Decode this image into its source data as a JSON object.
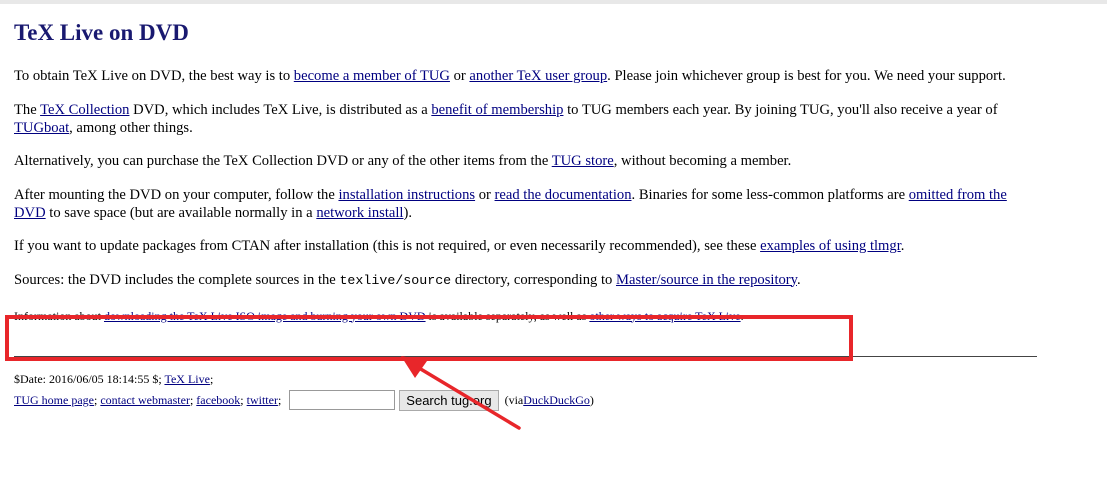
{
  "title": "TeX Live on DVD",
  "para1": {
    "t1": "To obtain TeX Live on DVD, the best way is to ",
    "link1": "become a member of TUG",
    "t2": " or ",
    "link2": "another TeX user group",
    "t3": ". Please join whichever group is best for you. We need your support."
  },
  "para2": {
    "t1": "The ",
    "link1": "TeX Collection",
    "t2": " DVD, which includes TeX Live, is distributed as a ",
    "link2": "benefit of membership",
    "t3": " to TUG members each year. By joining TUG, you'll also receive a year of ",
    "link3": "TUGboat",
    "t4": ", among other things."
  },
  "para3": {
    "t1": "Alternatively, you can purchase the TeX Collection DVD or any of the other items from the ",
    "link1": "TUG store",
    "t2": ", without becoming a member."
  },
  "para4": {
    "t1": "After mounting the DVD on your computer, follow the ",
    "link1": "installation instructions",
    "t2": " or ",
    "link2": "read the documentation",
    "t3": ". Binaries for some less-common platforms are ",
    "link3": "omitted from the DVD",
    "t4": " to save space (but are available normally in a ",
    "link4": "network install",
    "t5": ")."
  },
  "para5": {
    "t1": "If you want to update packages from CTAN after installation (this is not required, or even necessarily recommended), see these ",
    "link1": "examples of using tlmgr",
    "t2": "."
  },
  "para6": {
    "t1": "Sources: the DVD includes the complete sources in the ",
    "code": "texlive/source",
    "t2": " directory, corresponding to ",
    "link1": "Master/source in the repository",
    "t3": "."
  },
  "para7": {
    "t1": "Information about ",
    "link1": "downloading the TeX Live ISO image and burning your own DVD",
    "t2": " is available separately, as well as ",
    "link2": "other ways to acquire TeX Live",
    "t3": "."
  },
  "footer": {
    "date": "$Date: 2016/06/05 18:14:55 $; ",
    "texlive_link": "TeX Live",
    "sep": ";",
    "home_link": "TUG home page",
    "contact_link": "contact webmaster",
    "facebook_link": "facebook",
    "twitter_link": "twitter",
    "search_value": "",
    "search_button": "Search tug.org",
    "via": "(via ",
    "ddg_link": "DuckDuckGo",
    "via_end": ")"
  },
  "colors": {
    "title": "#191970",
    "link": "#000080",
    "highlight": "#e8262a"
  }
}
